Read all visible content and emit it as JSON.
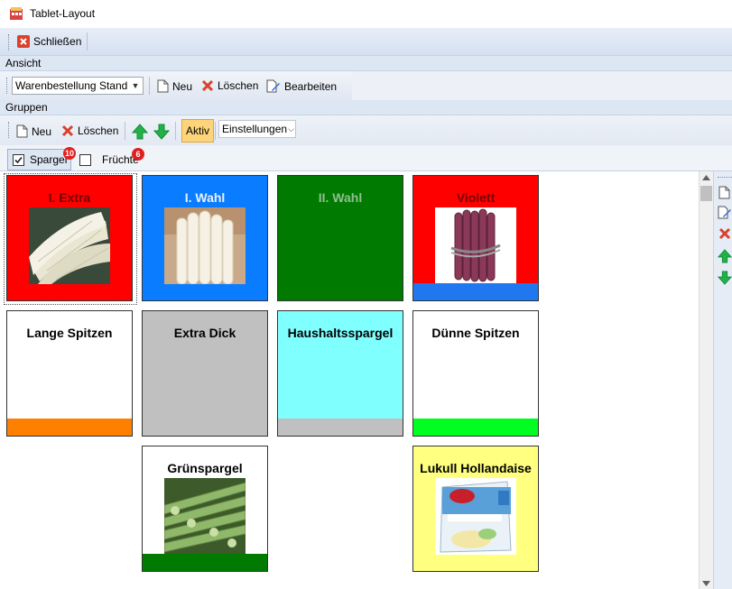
{
  "window": {
    "title": "Tablet-Layout"
  },
  "toolbar_main": {
    "close_label": "Schließen"
  },
  "sections": {
    "view_label": "Ansicht",
    "groups_label": "Gruppen"
  },
  "view_toolbar": {
    "layout_select_value": "Warenbestellung Stand",
    "new_label": "Neu",
    "delete_label": "Löschen",
    "edit_label": "Bearbeiten"
  },
  "groups_toolbar": {
    "new_label": "Neu",
    "delete_label": "Löschen",
    "active_label": "Aktiv",
    "settings_select_value": "Einstellungen"
  },
  "tabs": [
    {
      "label": "Spargel",
      "checked": true,
      "count": "10"
    },
    {
      "label": "Früchte",
      "checked": false,
      "count": "6"
    }
  ],
  "tiles": [
    {
      "label": "I. Extra",
      "bg": "#ff0000",
      "bar": null,
      "photo": "white-asparagus-bundle"
    },
    {
      "label": "I. Wahl",
      "bg": "#0a7cff",
      "bar": null,
      "photo": "white-asparagus-thick"
    },
    {
      "label": "II. Wahl",
      "bg": "#007a00",
      "bar": null,
      "photo": null
    },
    {
      "label": "Violett",
      "bg": "#ff0000",
      "bar": "#1f78f0",
      "photo": "violet-asparagus"
    },
    {
      "label": "Lange Spitzen",
      "bg": "#ffffff",
      "bar": "#ff8000",
      "photo": null
    },
    {
      "label": "Extra Dick",
      "bg": "#c0c0c0",
      "bar": null,
      "photo": null
    },
    {
      "label": "Haushaltsspargel",
      "bg": "#80ffff",
      "bar": "#c0c0c0",
      "photo": null
    },
    {
      "label": "Dünne Spitzen",
      "bg": "#ffffff",
      "bar": "#00ff20",
      "photo": null
    },
    {
      "label": "Grünspargel",
      "bg": "#ffffff",
      "bar": "#007a00",
      "photo": "green-asparagus"
    },
    {
      "label": "Lukull Hollandaise",
      "bg": "#ffff80",
      "bar": null,
      "photo": "hollandaise-package"
    }
  ]
}
